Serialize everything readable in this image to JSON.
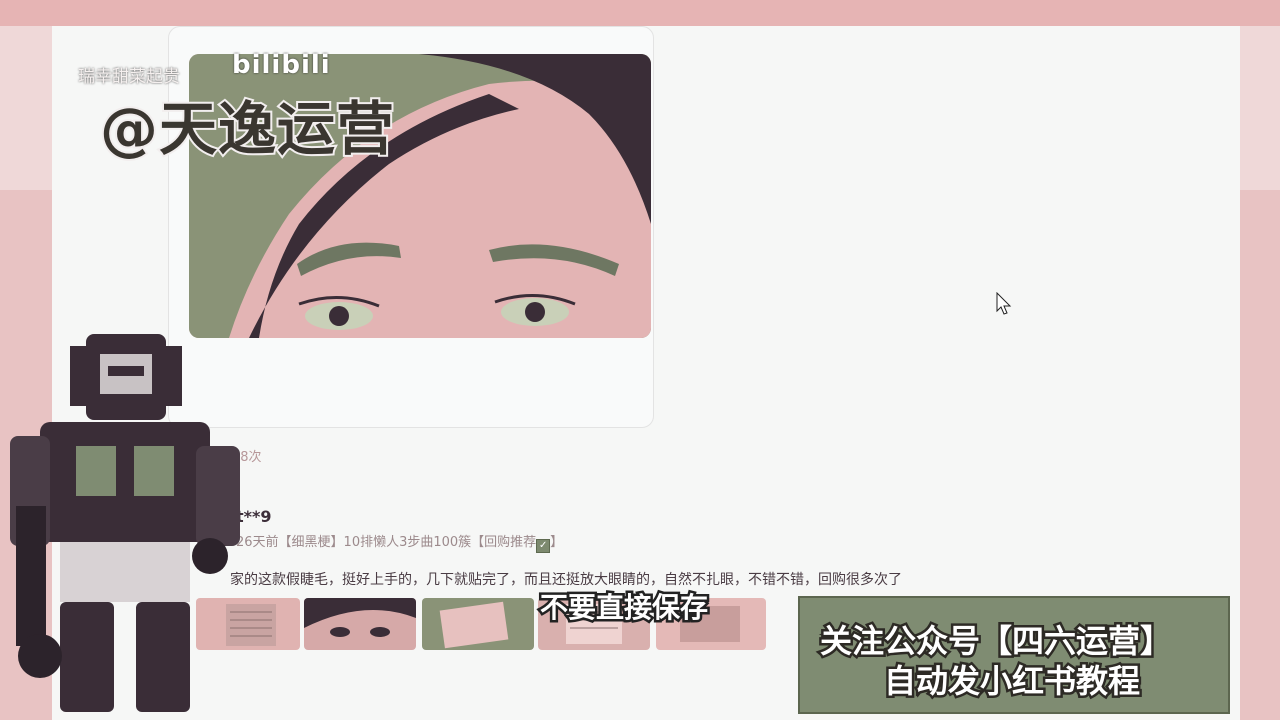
{
  "watermark_small": "瑞幸甜菜起贵",
  "bili_logo": "bilibili",
  "creator_handle": "@天逸运营",
  "post": {
    "views": "48次"
  },
  "review": {
    "user": "t**9",
    "meta_prefix": "26天前【细黑梗】10排懒人3步曲100簇【回购推荐",
    "meta_check": "✓",
    "meta_suffix": "】",
    "text": "家的这款假睫毛，挺好上手的，几下就贴完了，而且还挺放大眼睛的，自然不扎眼，不错不错，回购很多次了"
  },
  "subtitle": "不要直接保存",
  "promo": {
    "line1": "关注公众号【四六运营】",
    "line2": "自动发小红书教程"
  },
  "colors": {
    "accent_green": "#7f8c72",
    "pink_bg": "#e8b6b6"
  },
  "icons": {
    "cursor": "mouse-pointer-icon"
  }
}
